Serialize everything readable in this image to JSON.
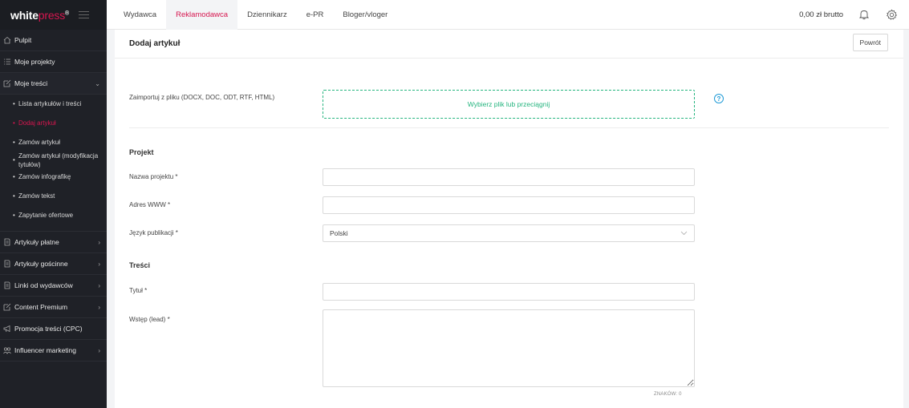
{
  "brand": {
    "logo_main": "white",
    "logo_accent": "press",
    "logo_mark": "®"
  },
  "sidebar": {
    "items": [
      {
        "label": "Pulpit",
        "icon": "home-icon"
      },
      {
        "label": "Moje projekty",
        "icon": "list-icon"
      },
      {
        "label": "Moje treści",
        "icon": "edit-icon"
      },
      {
        "label": "Artykuły płatne",
        "icon": "document-icon"
      },
      {
        "label": "Artykuły gościnne",
        "icon": "document-icon"
      },
      {
        "label": "Linki od wydawców",
        "icon": "document-icon"
      },
      {
        "label": "Content Premium",
        "icon": "edit-icon"
      },
      {
        "label": "Promocja treści (CPC)",
        "icon": "megaphone-icon"
      },
      {
        "label": "Influencer marketing",
        "icon": "people-icon"
      }
    ],
    "sub_items": [
      {
        "label": "Lista artykułów i treści"
      },
      {
        "label": "Dodaj artykuł"
      },
      {
        "label": "Zamów artykuł"
      },
      {
        "label": "Zamów artykuł (modyfikacja tytułów)"
      },
      {
        "label": "Zamów infografikę"
      },
      {
        "label": "Zamów tekst"
      },
      {
        "label": "Zapytanie ofertowe"
      }
    ],
    "bullet": "•"
  },
  "topbar": {
    "tabs": [
      {
        "label": "Wydawca"
      },
      {
        "label": "Reklamodawca"
      },
      {
        "label": "Dziennikarz"
      },
      {
        "label": "e-PR"
      },
      {
        "label": "Bloger/vloger"
      }
    ],
    "balance": "0,00 zł brutto"
  },
  "page": {
    "title": "Dodaj artykuł",
    "back_label": "Powrót",
    "import_label": "Zaimportuj z pliku (DOCX, DOC, ODT, RTF, HTML)",
    "dropzone_text": "Wybierz plik lub przeciągnij",
    "help_glyph": "?",
    "section_project": "Projekt",
    "project_name_label": "Nazwa projektu *",
    "website_label": "Adres WWW *",
    "language_label": "Język publikacji *",
    "language_value": "Polski",
    "section_content": "Treści",
    "title_label": "Tytuł *",
    "lead_label": "Wstęp (lead) *",
    "counter": "ZNAKÓW: 0"
  },
  "colors": {
    "accent": "#d6164f",
    "green": "#24b47e",
    "sidebar_bg": "#1f2127",
    "help_blue": "#1e9ad6"
  }
}
